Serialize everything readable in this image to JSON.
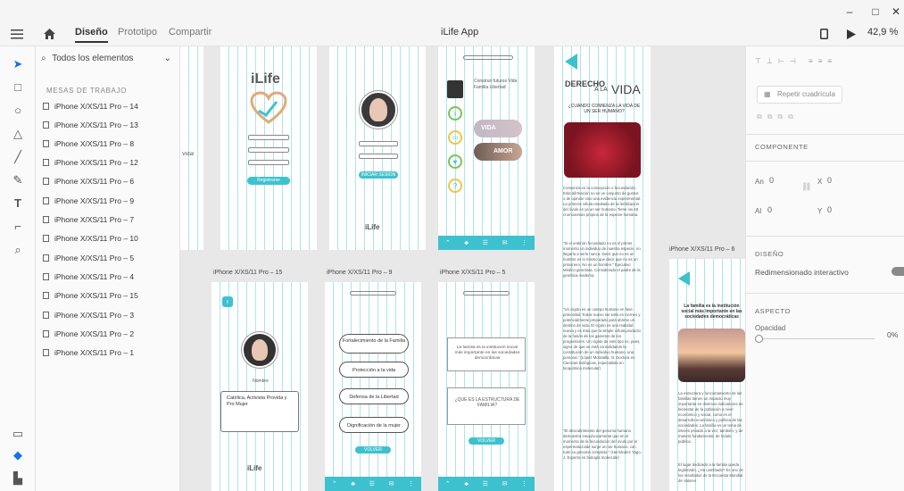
{
  "window": {
    "minimize": "–",
    "maximize": "□",
    "close": "✕"
  },
  "toolbar": {
    "tabs": [
      {
        "label": "Diseño"
      },
      {
        "label": "Prototipo"
      },
      {
        "label": "Compartir"
      }
    ],
    "doc_title": "iLife App",
    "zoom": "42,9 %"
  },
  "layers": {
    "search_label": "Todos los elementos",
    "section_title": "MESAS DE TRABAJO",
    "items": [
      {
        "label": "iPhone X/XS/11 Pro – 14"
      },
      {
        "label": "iPhone X/XS/11 Pro – 13"
      },
      {
        "label": "iPhone X/XS/11 Pro – 8"
      },
      {
        "label": "iPhone X/XS/11 Pro – 12"
      },
      {
        "label": "iPhone X/XS/11 Pro – 6"
      },
      {
        "label": "iPhone X/XS/11 Pro – 9"
      },
      {
        "label": "iPhone X/XS/11 Pro – 7"
      },
      {
        "label": "iPhone X/XS/11 Pro – 10"
      },
      {
        "label": "iPhone X/XS/11 Pro – 5"
      },
      {
        "label": "iPhone X/XS/11 Pro – 4"
      },
      {
        "label": "iPhone X/XS/11 Pro – 15"
      },
      {
        "label": "iPhone X/XS/11 Pro – 3"
      },
      {
        "label": "iPhone X/XS/11 Pro – 2"
      },
      {
        "label": "iPhone X/XS/11 Pro – 1"
      }
    ]
  },
  "canvas": {
    "labels": {
      "ab15": "iPhone X/XS/11 Pro – 15",
      "ab9": "iPhone X/XS/11 Pro – 9",
      "ab5": "iPhone X/XS/11 Pro – 5",
      "ab6": "iPhone X/XS/11 Pro – 6"
    },
    "partial_label": "Vida!",
    "login": {
      "logo": "iLife",
      "button": "Registrarse"
    },
    "profile": {
      "button": "INICIAR SESION"
    },
    "menu": {
      "heading": "Construir futuros Vida Familia Libertad",
      "chip1": "VIDA",
      "chip2": "AMOR"
    },
    "article": {
      "title1": "DERECHO",
      "title2": "A LA",
      "title3": "VIDA",
      "question": "¿CUÁNDO COMIENZA LA VIDA DE UN SER HUMANO?",
      "para1": "Comienza en la concepción o fecundación. Esta afirmación no es un conjunto de gustos o de opinión sino una evidencia experimental. La primera célula resultado de la fertilización del óvulo es ya un ser humano. Tiene los 46 cromosomas propios de la especie humana.",
      "para2": "\"Si el embrión fecundado no es el primer momento un individuo de nuestra especie, no llegaría a serlo nunca. Decir que no es un hombre es lo mismo que decir que no es un prisionero. No es un hombre.\" Ejecutivo Médico genetista. Considerado el padre de la genética moderna.",
      "para3": "\"Un cigoto es un cuerpo humano en fase primordial. Todos nuevo ser está en ciernes y potencialmente preparado para abrirse un destino de vida. El cigoto es una realidad nueva y es más que la simple célula producto de la fusión de los gametos de los progenitores. Un cigoto de este tipo es, pues, signo de que se está consolidando la constitución de un individuo humano, una persona.\" (López Moratalla, N. Doctora en Ciencias biológicas, especialista en bioquímica molecular)",
      "para4": "\"El descubrimiento del genoma humano demuestra inequívocamente que en el momento de la fecundación del óvulo por el espermatozoide surge un ser humano, con todo su genoma completo.\" (Hernández Yago, J. Experto en biología molecular)"
    },
    "profile2": {
      "name": "Nombre",
      "bio": "Católica, Activista Provida y Pro Mujer",
      "logo": "iLife"
    },
    "pills": {
      "p1": "Fortalecimiento de la Familia",
      "p2": "Protección a la vida",
      "p3": "Defensa de la Libertad",
      "p4": "Dignificación de la mujer",
      "button": "VOLVER"
    },
    "family": {
      "box1": "La familia es la institución social más importante en las sociedades democráticas",
      "box2": "¿QUÉ ES LA ESTRUCTURA DE FAMILIA?",
      "button": "VOLVER"
    },
    "ab6": {
      "heading": "La familia es la institución social más importante en las sociedades democráticas",
      "para": "La estructura y funcionamiento de las familias tienen un impacto muy importante en diversos indicadores de bienestar de la población a nivel económico y social, como es el desarrollo económico y política de las sociedades. La familia es un tema de interés privado a la vez, también, y de manera fundamental, de índole pública.",
      "para2": "El lugar dedicado a la familia queda legitimado. ¿Ha cambiado? Es uno de los resultados de la Encuesta Mundial de Valores"
    },
    "logo_small": "iLife"
  },
  "right_panel": {
    "repeat_grid": "Repetir cuadrícula",
    "component": "COMPONENTE",
    "an_label": "An",
    "an_value": "0",
    "al_label": "Al",
    "al_value": "0",
    "x_label": "X",
    "x_value": "0",
    "y_label": "Y",
    "y_value": "0",
    "design": "DISEÑO",
    "responsive": "Redimensionado interactivo",
    "aspect": "ASPECTO",
    "opacity_label": "Opacidad",
    "opacity_value": "0%",
    "opacity": 0
  },
  "colors": {
    "accent": "#3ec1cf",
    "heart": "#e0aa7a"
  }
}
